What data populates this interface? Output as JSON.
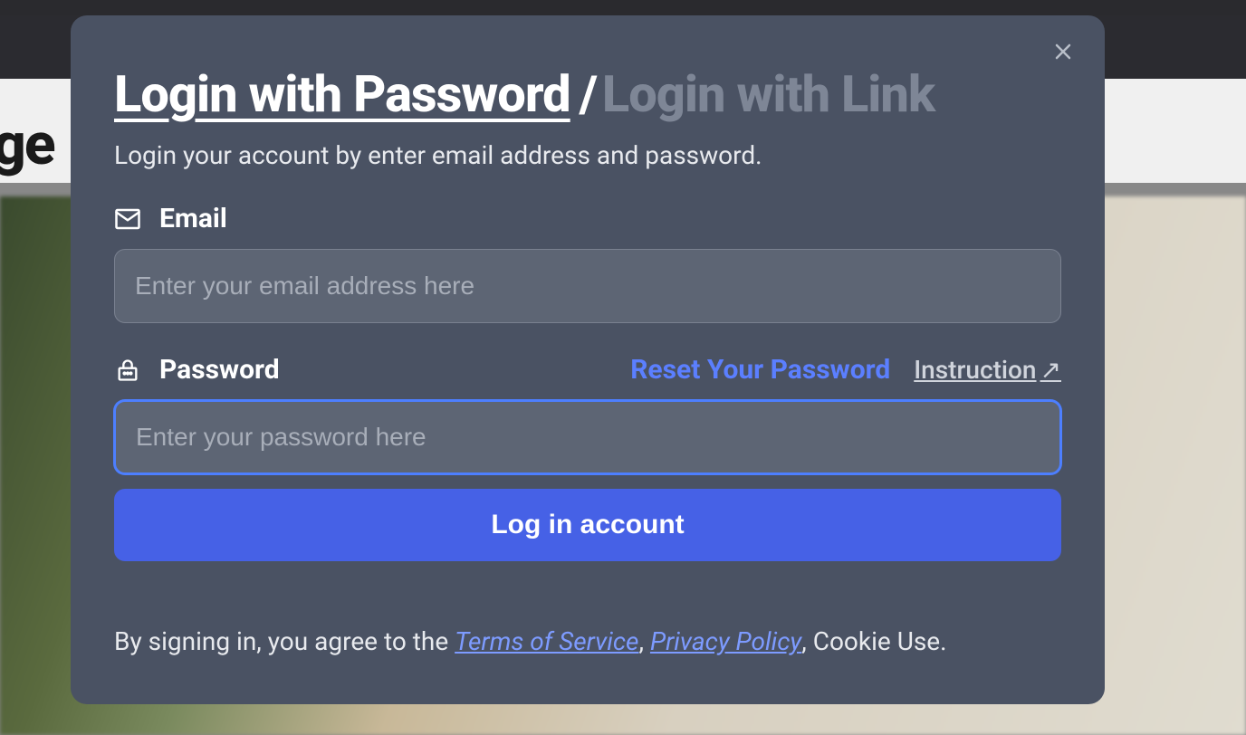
{
  "background": {
    "partial_heading": "age"
  },
  "modal": {
    "tabs": {
      "active": "Login with Password",
      "separator": "/",
      "inactive": "Login with Link"
    },
    "subtitle": "Login your account by enter email address and password.",
    "email": {
      "label": "Email",
      "placeholder": "Enter your email address here",
      "value": ""
    },
    "password": {
      "label": "Password",
      "reset_link": "Reset Your Password",
      "instruction_link": "Instruction",
      "instruction_arrow": "↗",
      "placeholder": "Enter your password here",
      "value": ""
    },
    "submit_label": "Log in account",
    "footer": {
      "prefix": "By signing in, you agree to the ",
      "tos": "Terms of Service",
      "comma1": ", ",
      "privacy": "Privacy Policy",
      "suffix": ", Cookie Use."
    }
  }
}
